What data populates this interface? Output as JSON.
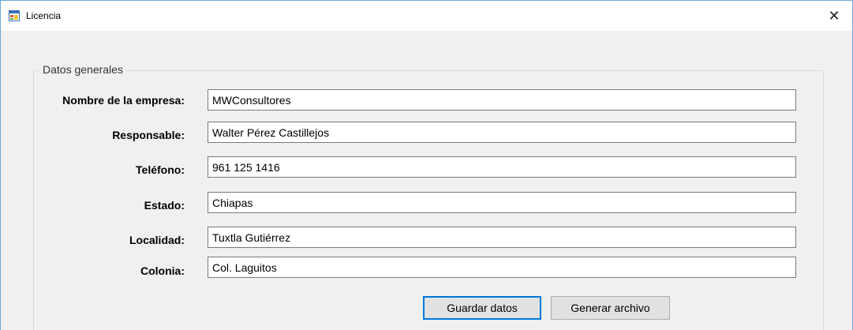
{
  "window": {
    "title": "Licencia",
    "close_glyph": "✕",
    "icon": "app-window-icon"
  },
  "group": {
    "legend": "Datos generales"
  },
  "fields": [
    {
      "label": "Nombre de la empresa:",
      "value": "MWConsultores"
    },
    {
      "label": "Responsable:",
      "value": "Walter Pérez Castillejos"
    },
    {
      "label": "Teléfono:",
      "value": "961 125 1416"
    },
    {
      "label": "Estado:",
      "value": "Chiapas"
    },
    {
      "label": "Localidad:",
      "value": "Tuxtla Gutiérrez"
    },
    {
      "label": "Colonia:",
      "value": "Col. Laguitos"
    }
  ],
  "buttons": {
    "save": "Guardar datos",
    "generate": "Generar archivo"
  }
}
